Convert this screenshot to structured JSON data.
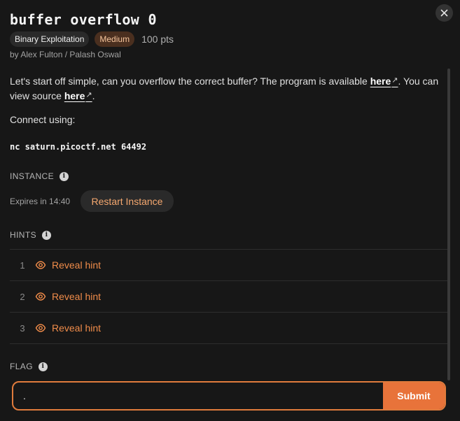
{
  "challenge": {
    "title": "buffer overflow 0",
    "category": "Binary Exploitation",
    "difficulty": "Medium",
    "points": "100 pts",
    "authors": "by Alex Fulton / Palash Oswal"
  },
  "description": {
    "part1": "Let's start off simple, can you overflow the correct buffer? The program is available ",
    "link1": "here",
    "part2": ". You can view source ",
    "link2": "here",
    "part3": ".",
    "ext_glyph": "↗"
  },
  "connect": {
    "label": "Connect using:",
    "command": "nc saturn.picoctf.net 64492"
  },
  "instance": {
    "label": "INSTANCE",
    "expires": "Expires in 14:40",
    "restart_label": "Restart Instance"
  },
  "hints": {
    "label": "HINTS",
    "items": [
      {
        "number": "1",
        "label": "Reveal hint"
      },
      {
        "number": "2",
        "label": "Reveal hint"
      },
      {
        "number": "3",
        "label": "Reveal hint"
      }
    ]
  },
  "flag": {
    "label": "FLAG",
    "value": ".",
    "submit_label": "Submit"
  },
  "colors": {
    "accent": "#e8733a",
    "link_accent": "#f08c4a",
    "background": "#171717"
  },
  "icons": {
    "close": "close-icon",
    "info": "info-icon",
    "reveal": "eye-icon",
    "external": "external-link-icon"
  }
}
